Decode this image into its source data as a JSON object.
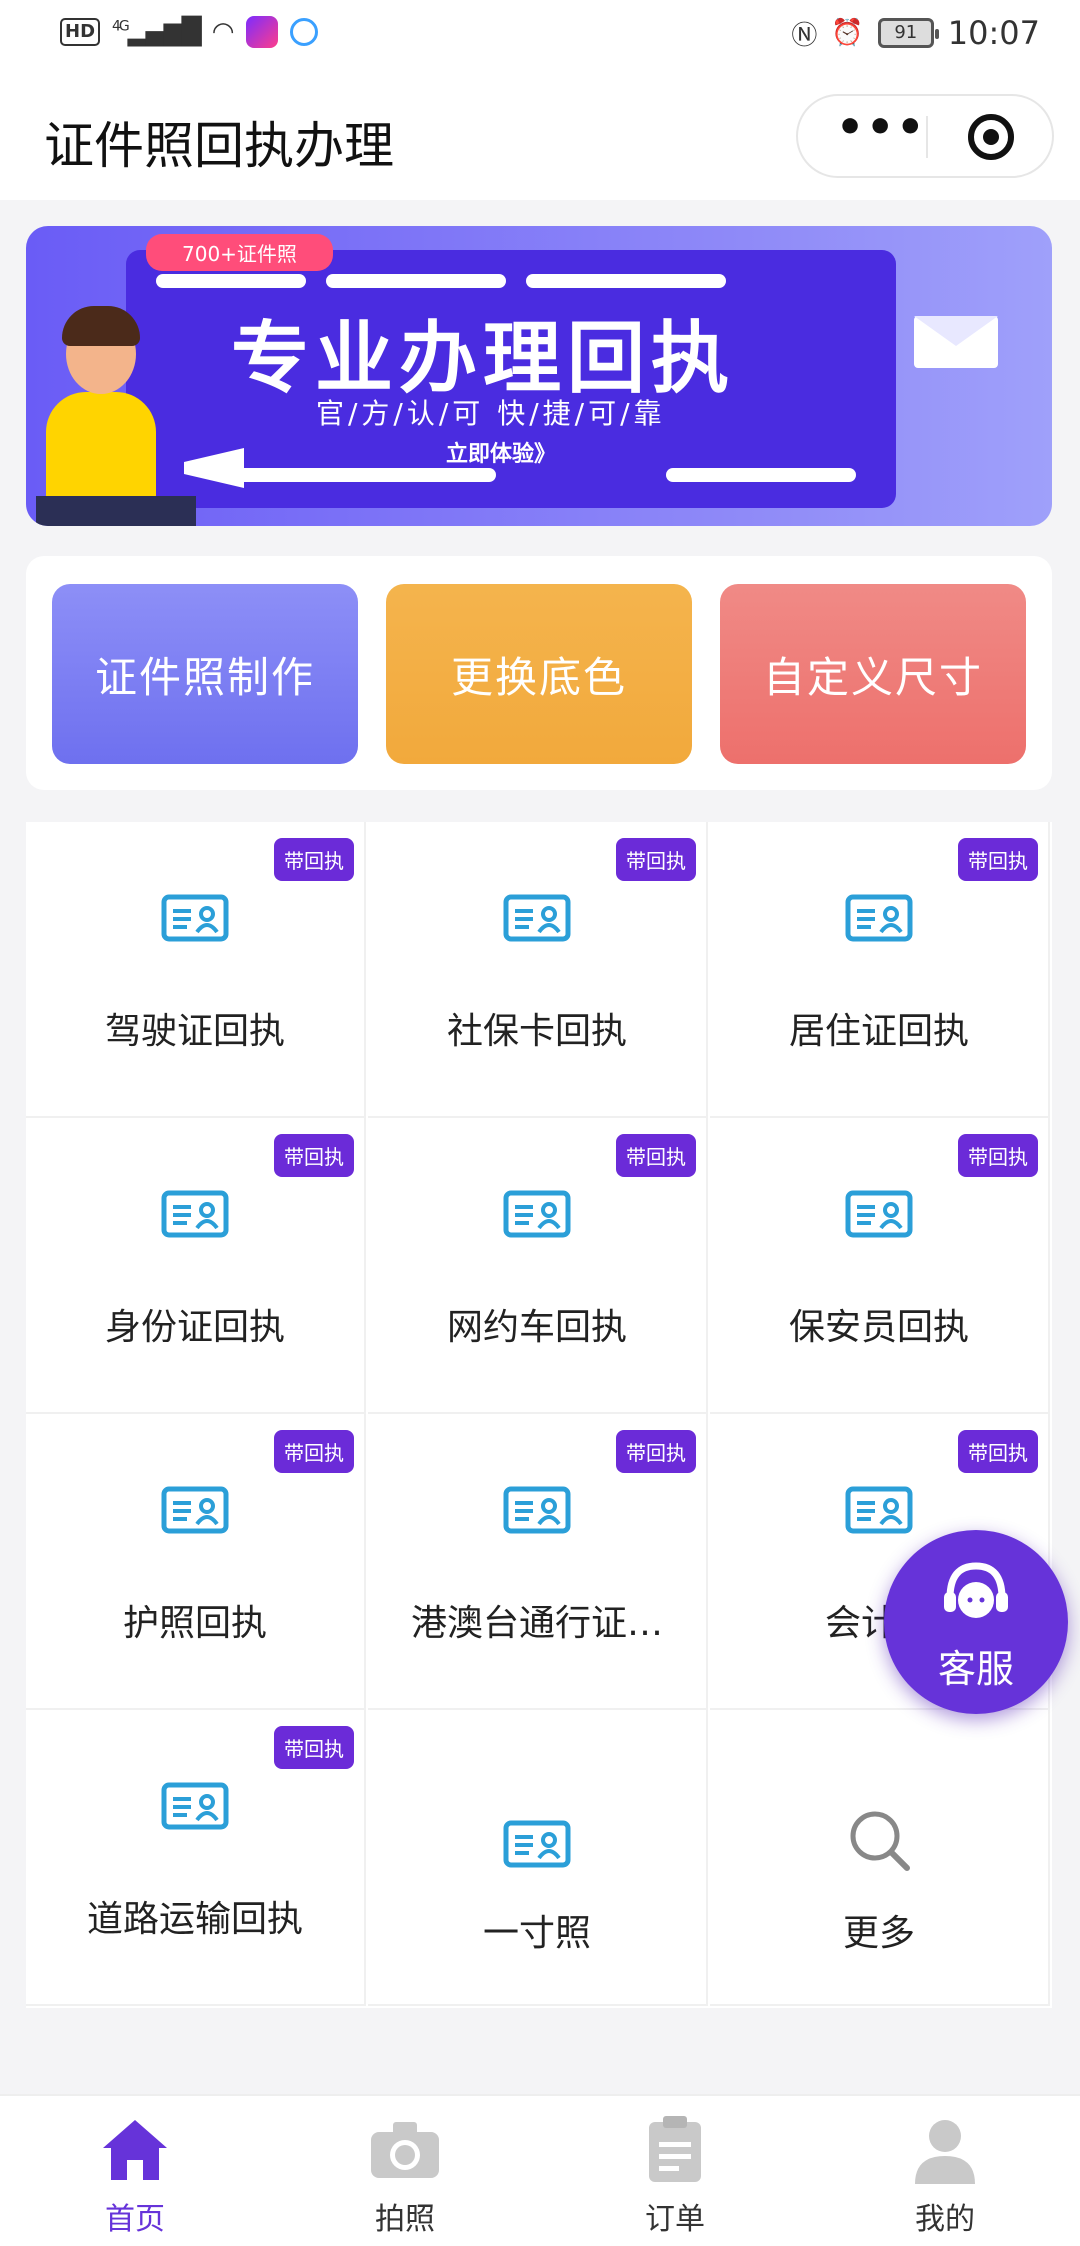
{
  "status_bar": {
    "hd": "HD",
    "network": "4G",
    "battery": "91",
    "time": "10:07"
  },
  "header": {
    "title": "证件照回执办理",
    "more_icon": "more-dots-icon",
    "close_icon": "target-icon"
  },
  "banner": {
    "tag": "700+证件照",
    "title": "专业办理回执",
    "subtitle": "官/方/认/可    快/捷/可/靠",
    "cta": "立即体验》"
  },
  "quick_actions": [
    {
      "label": "证件照制作",
      "color": "#7b7df3"
    },
    {
      "label": "更换底色",
      "color": "#f3ae44"
    },
    {
      "label": "自定义尺寸",
      "color": "#ee7a76"
    }
  ],
  "services": [
    {
      "label": "驾驶证回执",
      "badge": "带回执",
      "icon": "id-card-icon"
    },
    {
      "label": "社保卡回执",
      "badge": "带回执",
      "icon": "id-card-icon"
    },
    {
      "label": "居住证回执",
      "badge": "带回执",
      "icon": "id-card-icon"
    },
    {
      "label": "身份证回执",
      "badge": "带回执",
      "icon": "id-card-icon"
    },
    {
      "label": "网约车回执",
      "badge": "带回执",
      "icon": "id-card-icon"
    },
    {
      "label": "保安员回执",
      "badge": "带回执",
      "icon": "id-card-icon"
    },
    {
      "label": "护照回执",
      "badge": "带回执",
      "icon": "id-card-icon"
    },
    {
      "label": "港澳台通行证…",
      "badge": "带回执",
      "icon": "id-card-icon"
    },
    {
      "label": "会计考",
      "badge": "带回执",
      "icon": "id-card-icon"
    },
    {
      "label": "道路运输回执",
      "badge": "带回执",
      "icon": "id-card-icon"
    },
    {
      "label": "一寸照",
      "badge": "",
      "icon": "id-card-icon"
    },
    {
      "label": "更多",
      "badge": "",
      "icon": "search-icon"
    }
  ],
  "fab": {
    "label": "客服",
    "icon": "customer-service-icon"
  },
  "tabbar": [
    {
      "label": "首页",
      "icon": "home-icon",
      "active": true
    },
    {
      "label": "拍照",
      "icon": "camera-icon",
      "active": false
    },
    {
      "label": "订单",
      "icon": "clipboard-icon",
      "active": false
    },
    {
      "label": "我的",
      "icon": "user-icon",
      "active": false
    }
  ],
  "colors": {
    "accent": "#6633d9",
    "badge": "#6b2bd8",
    "icon_blue": "#2b9fd8"
  }
}
